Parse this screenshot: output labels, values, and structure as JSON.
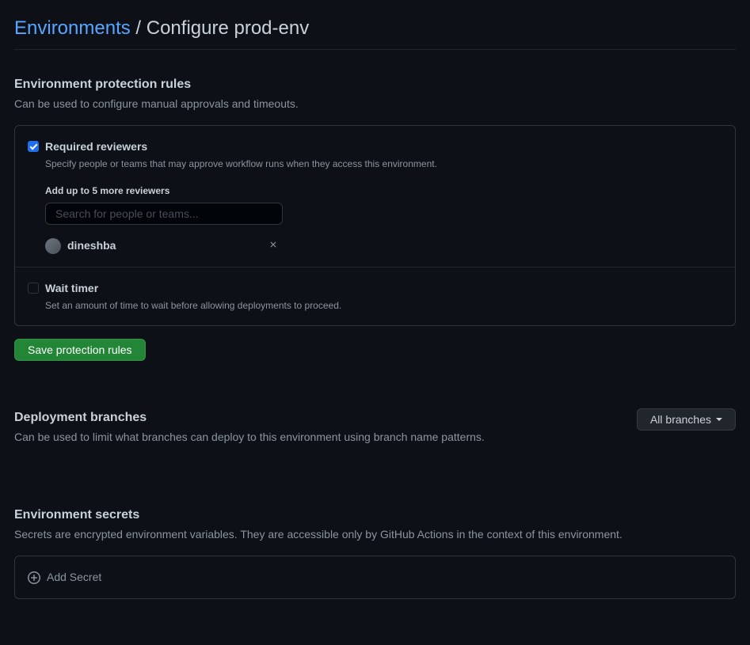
{
  "breadcrumb": {
    "parent": "Environments",
    "separator": "/",
    "current": "Configure prod-env"
  },
  "protection": {
    "title": "Environment protection rules",
    "desc": "Can be used to configure manual approvals and timeouts.",
    "required_reviewers": {
      "label": "Required reviewers",
      "desc": "Specify people or teams that may approve workflow runs when they access this environment.",
      "checked": true,
      "add_label": "Add up to 5 more reviewers",
      "search_placeholder": "Search for people or teams...",
      "reviewers": [
        {
          "name": "dineshba"
        }
      ]
    },
    "wait_timer": {
      "label": "Wait timer",
      "desc": "Set an amount of time to wait before allowing deployments to proceed.",
      "checked": false
    },
    "save_button": "Save protection rules"
  },
  "branches": {
    "title": "Deployment branches",
    "desc": "Can be used to limit what branches can deploy to this environment using branch name patterns.",
    "dropdown": "All branches"
  },
  "secrets": {
    "title": "Environment secrets",
    "desc": "Secrets are encrypted environment variables. They are accessible only by GitHub Actions in the context of this environment.",
    "add_button": "Add Secret"
  }
}
